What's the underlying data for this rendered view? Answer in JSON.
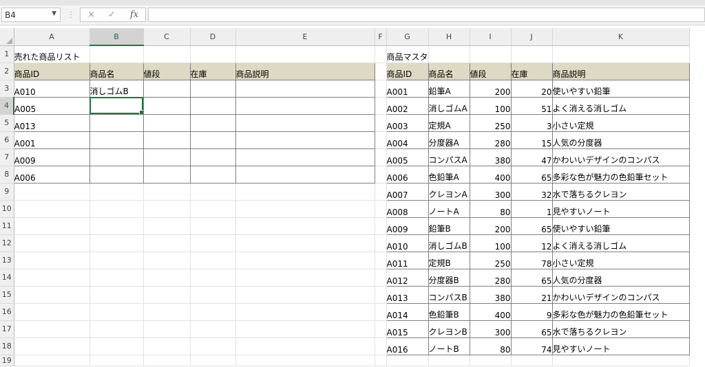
{
  "formula_bar": {
    "name_box": "B4",
    "name_box_icon": "dropdown-arrow-icon",
    "cancel_icon": "×",
    "enter_icon": "✓",
    "function_icon": "fx",
    "formula": ""
  },
  "columns": [
    "A",
    "B",
    "C",
    "D",
    "E",
    "F",
    "G",
    "H",
    "I",
    "J",
    "K"
  ],
  "selected_column": "B",
  "selected_row": 4,
  "active_cell": "B4",
  "row_numbers": [
    1,
    2,
    3,
    4,
    5,
    6,
    7,
    8,
    9,
    10,
    11,
    12,
    13,
    14,
    15,
    16,
    17,
    18,
    19
  ],
  "sold": {
    "title": "売れた商品リスト",
    "headers": [
      "商品ID",
      "商品名",
      "値段",
      "在庫",
      "商品説明"
    ],
    "rows": [
      {
        "id": "A010",
        "name": "消しゴムB",
        "price": "",
        "stock": "",
        "desc": ""
      },
      {
        "id": "A005",
        "name": "",
        "price": "",
        "stock": "",
        "desc": ""
      },
      {
        "id": "A013",
        "name": "",
        "price": "",
        "stock": "",
        "desc": ""
      },
      {
        "id": "A001",
        "name": "",
        "price": "",
        "stock": "",
        "desc": ""
      },
      {
        "id": "A009",
        "name": "",
        "price": "",
        "stock": "",
        "desc": ""
      },
      {
        "id": "A006",
        "name": "",
        "price": "",
        "stock": "",
        "desc": ""
      }
    ]
  },
  "master": {
    "title": "商品マスタ",
    "headers": [
      "商品ID",
      "商品名",
      "値段",
      "在庫",
      "商品説明"
    ],
    "rows": [
      {
        "id": "A001",
        "name": "鉛筆A",
        "price": "200",
        "stock": "20",
        "desc": "使いやすい鉛筆"
      },
      {
        "id": "A002",
        "name": "消しゴムA",
        "price": "100",
        "stock": "51",
        "desc": "よく消える消しゴム"
      },
      {
        "id": "A003",
        "name": "定規A",
        "price": "250",
        "stock": "3",
        "desc": "小さい定規"
      },
      {
        "id": "A004",
        "name": "分度器A",
        "price": "280",
        "stock": "15",
        "desc": "人気の分度器"
      },
      {
        "id": "A005",
        "name": "コンパスA",
        "price": "380",
        "stock": "47",
        "desc": "かわいいデザインのコンパス"
      },
      {
        "id": "A006",
        "name": "色鉛筆A",
        "price": "400",
        "stock": "65",
        "desc": "多彩な色が魅力の色鉛筆セット"
      },
      {
        "id": "A007",
        "name": "クレヨンA",
        "price": "300",
        "stock": "32",
        "desc": "水で落ちるクレヨン"
      },
      {
        "id": "A008",
        "name": "ノートA",
        "price": "80",
        "stock": "1",
        "desc": "見やすいノート"
      },
      {
        "id": "A009",
        "name": "鉛筆B",
        "price": "200",
        "stock": "65",
        "desc": "使いやすい鉛筆"
      },
      {
        "id": "A010",
        "name": "消しゴムB",
        "price": "100",
        "stock": "12",
        "desc": "よく消える消しゴム"
      },
      {
        "id": "A011",
        "name": "定規B",
        "price": "250",
        "stock": "78",
        "desc": "小さい定規"
      },
      {
        "id": "A012",
        "name": "分度器B",
        "price": "280",
        "stock": "65",
        "desc": "人気の分度器"
      },
      {
        "id": "A013",
        "name": "コンパスB",
        "price": "380",
        "stock": "21",
        "desc": "かわいいデザインのコンパス"
      },
      {
        "id": "A014",
        "name": "色鉛筆B",
        "price": "400",
        "stock": "9",
        "desc": "多彩な色が魅力の色鉛筆セット"
      },
      {
        "id": "A015",
        "name": "クレヨンB",
        "price": "300",
        "stock": "65",
        "desc": "水で落ちるクレヨン"
      },
      {
        "id": "A016",
        "name": "ノートB",
        "price": "80",
        "stock": "74",
        "desc": "見やすいノート"
      }
    ]
  },
  "colors": {
    "selection": "#217346",
    "header_fill": "#ddd9c4",
    "grid": "#e1e1e1"
  }
}
